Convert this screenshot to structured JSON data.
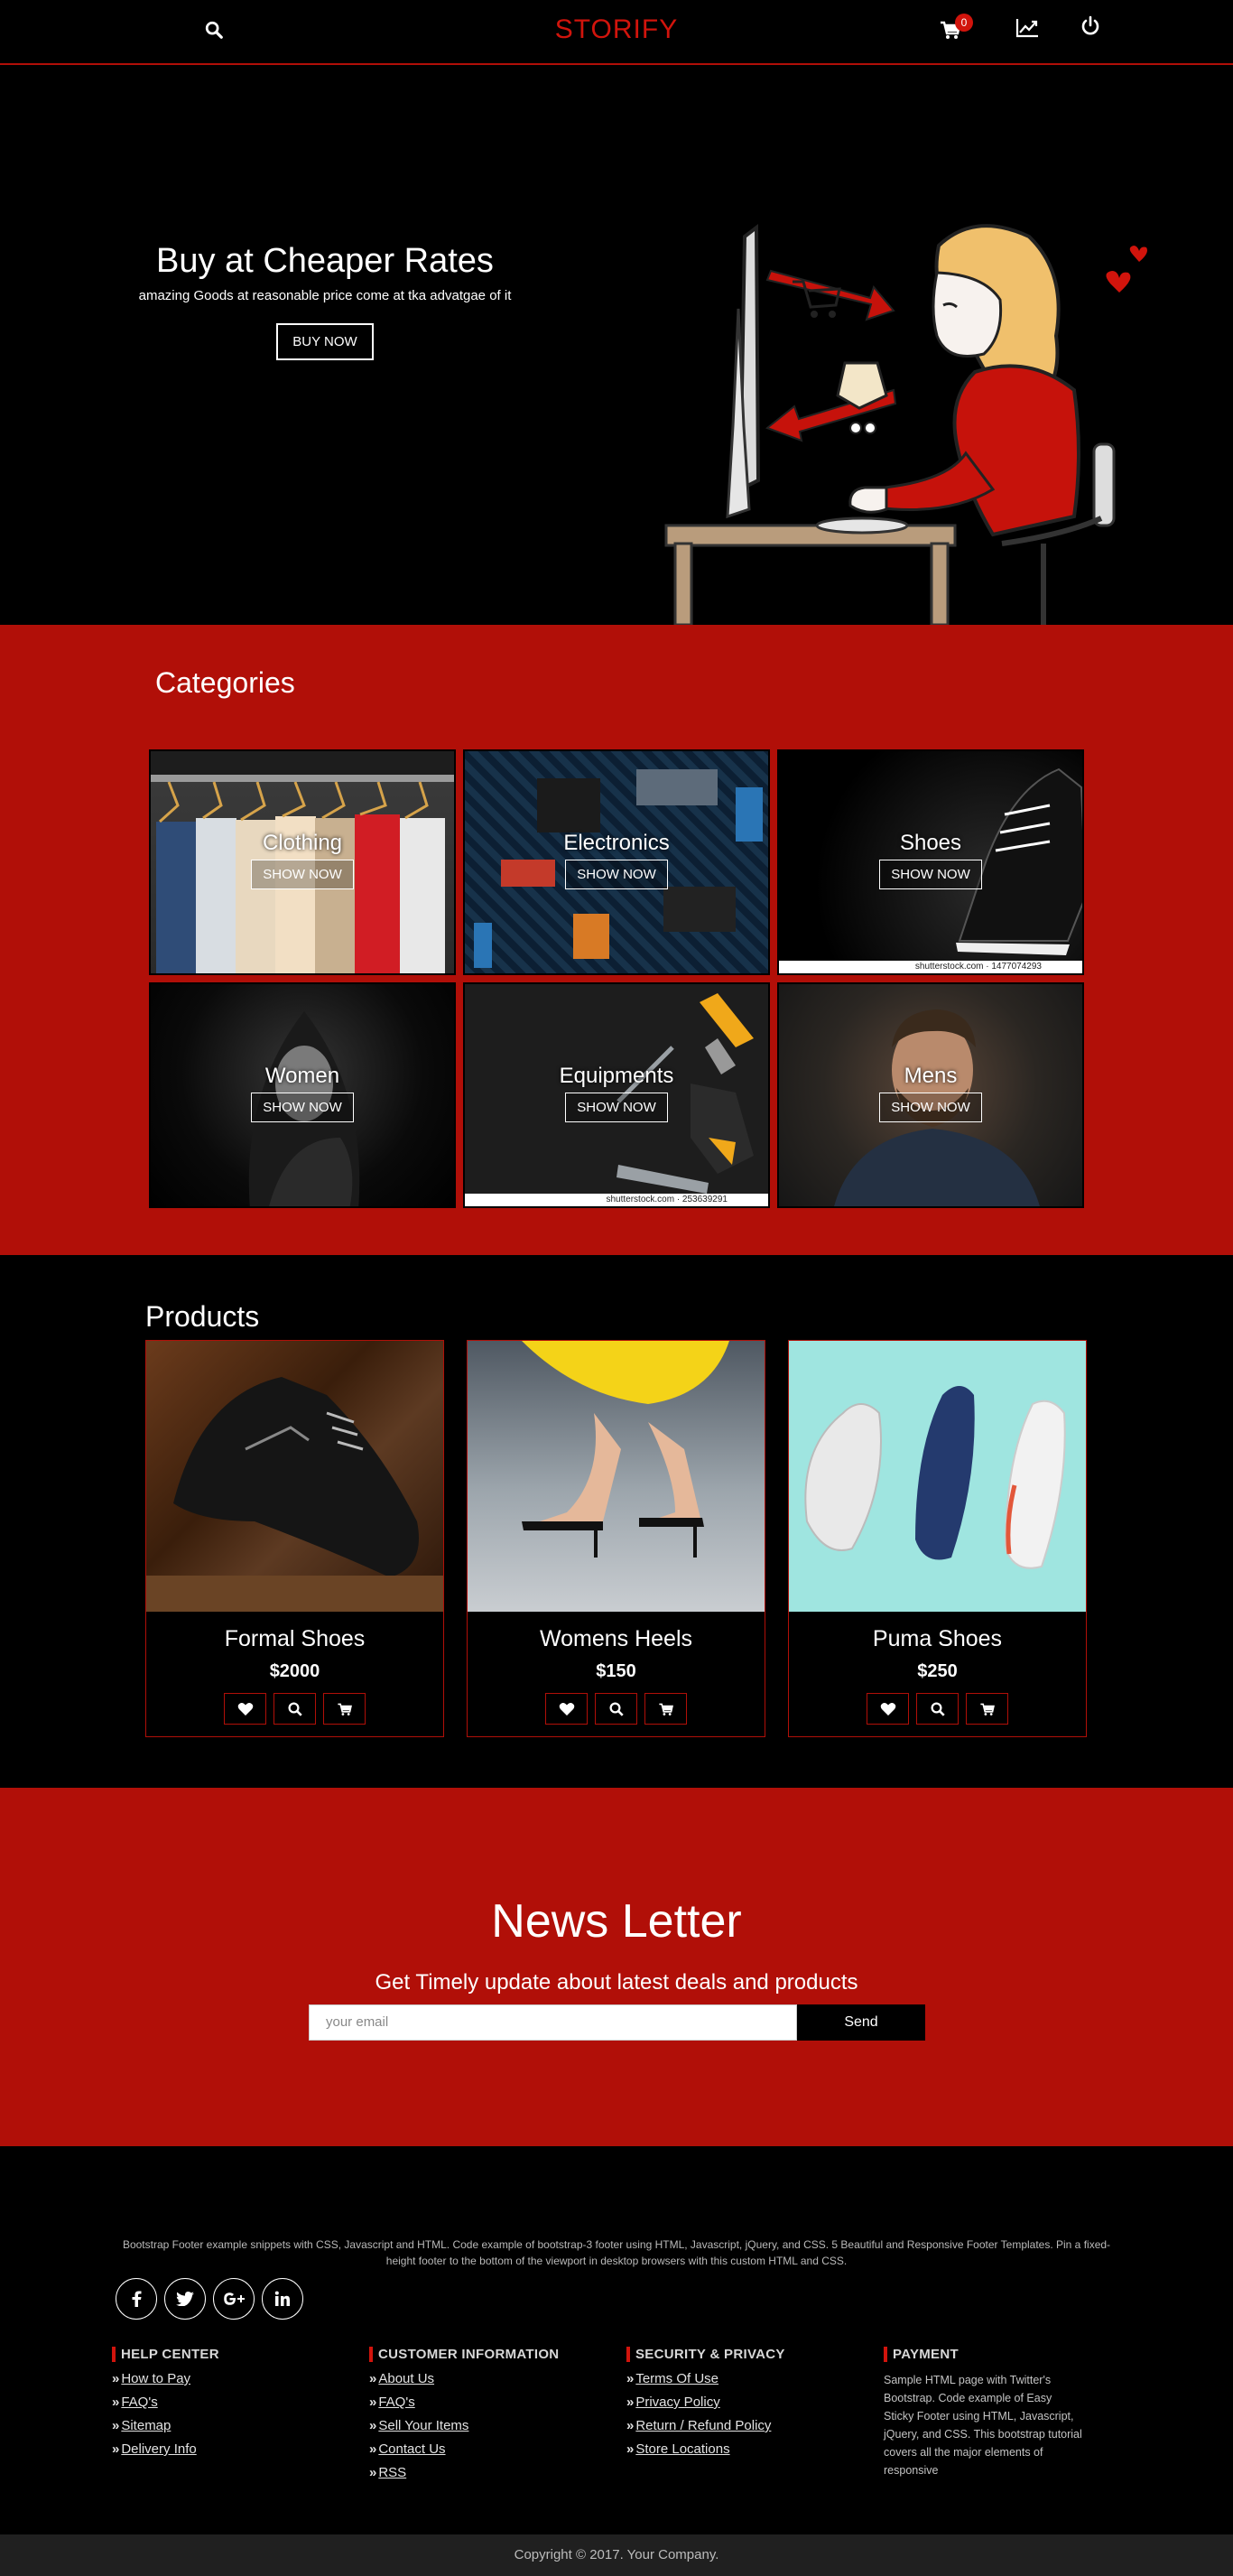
{
  "nav": {
    "brand": "STORIFY",
    "cart_count": "0"
  },
  "hero": {
    "title": "Buy at Cheaper Rates",
    "subtitle": "amazing Goods at reasonable price come at tka advatgae of it",
    "button": "BUY NOW"
  },
  "categories": {
    "heading": "Categories",
    "items": [
      {
        "name": "Clothing",
        "button": "SHOW NOW",
        "credit": ""
      },
      {
        "name": "Electronics",
        "button": "SHOW NOW",
        "credit": ""
      },
      {
        "name": "Shoes",
        "button": "SHOW NOW",
        "credit": "shutterstock.com · 1477074293"
      },
      {
        "name": "Women",
        "button": "SHOW NOW",
        "credit": ""
      },
      {
        "name": "Equipments",
        "button": "SHOW NOW",
        "credit": "shutterstock.com · 253639291"
      },
      {
        "name": "Mens",
        "button": "SHOW NOW",
        "credit": ""
      }
    ]
  },
  "products": {
    "heading": "Products",
    "items": [
      {
        "name": "Formal Shoes",
        "price": "$2000"
      },
      {
        "name": "Womens Heels",
        "price": "$150"
      },
      {
        "name": "Puma Shoes",
        "price": "$250"
      }
    ],
    "action_icons": [
      "heart-icon",
      "search-icon",
      "cart-icon"
    ]
  },
  "newsletter": {
    "title": "News Letter",
    "subtitle": "Get Timely update about latest deals and products",
    "placeholder": "your email",
    "button": "Send"
  },
  "footer": {
    "description": "Bootstrap Footer example snippets with CSS, Javascript and HTML. Code example of bootstrap-3 footer using HTML, Javascript, jQuery, and CSS. 5 Beautiful and Responsive Footer Templates. Pin a fixed-height footer to the bottom of the viewport in desktop browsers with this custom HTML and CSS.",
    "socials": [
      "facebook-icon",
      "twitter-icon",
      "google-plus-icon",
      "linkedin-icon"
    ],
    "help": {
      "heading": "HELP CENTER",
      "links": [
        "How to Pay",
        "FAQ's",
        "Sitemap",
        "Delivery Info"
      ]
    },
    "customer": {
      "heading": "CUSTOMER INFORMATION",
      "links": [
        "About Us",
        "FAQ's",
        "Sell Your Items",
        "Contact Us",
        "RSS"
      ]
    },
    "security": {
      "heading": "SECURITY & PRIVACY",
      "links": [
        "Terms Of Use",
        "Privacy Policy",
        "Return / Refund Policy",
        "Store Locations"
      ]
    },
    "payment": {
      "heading": "PAYMENT",
      "text": "Sample HTML page with Twitter's Bootstrap. Code example of Easy Sticky Footer using HTML, Javascript, jQuery, and CSS. This bootstrap tutorial covers all the major elements of responsive"
    },
    "copyright": "Copyright © 2017. Your Company."
  },
  "colors": {
    "accent": "#b10f08",
    "brand": "#d1140c",
    "background": "#000000"
  }
}
